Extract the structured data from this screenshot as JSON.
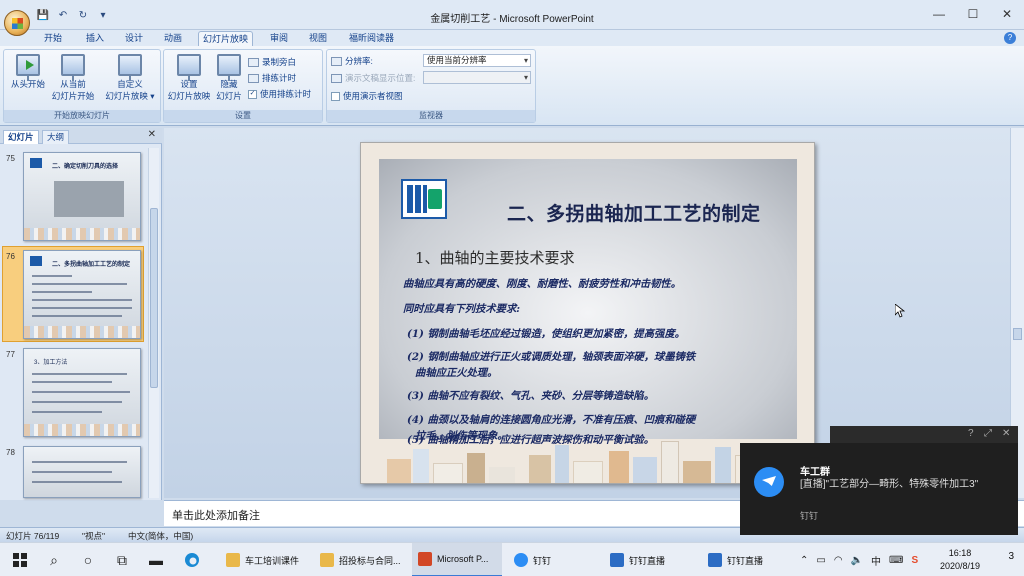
{
  "window": {
    "title": "金属切削工艺 - Microsoft PowerPoint"
  },
  "tabs": [
    "开始",
    "插入",
    "设计",
    "动画",
    "幻灯片放映",
    "审阅",
    "视图",
    "福昕阅读器"
  ],
  "ribbon": {
    "group_start": {
      "label": "开始放映幻灯片",
      "from_beginning": "从头开始",
      "from_current_1": "从当前",
      "from_current_2": "幻灯片开始",
      "custom_1": "自定义",
      "custom_2": "幻灯片放映 ▾"
    },
    "group_setup": {
      "label": "设置",
      "setup_1": "设置",
      "setup_2": "幻灯片放映",
      "hide_1": "隐藏",
      "hide_2": "幻灯片",
      "record": "录制旁白",
      "rehearse": "排练计时",
      "use_timings": "使用排练计时"
    },
    "group_monitors": {
      "label": "监视器",
      "resolution_label": "分辨率:",
      "resolution_value": "使用当前分辨率",
      "show_on_label": "演示文稿显示位置:",
      "presenter_view": "使用演示者视图"
    }
  },
  "left_pane": {
    "tab_slides": "幻灯片",
    "tab_outline": "大纲",
    "thumbnails": [
      {
        "num": "75",
        "title": "二、确定切削刀具的选择"
      },
      {
        "num": "76",
        "title": "二、多拐曲轴加工工艺的制定",
        "selected": true
      },
      {
        "num": "77",
        "title": "3、加工方法"
      },
      {
        "num": "78",
        "title": ""
      }
    ]
  },
  "slide": {
    "title": "二、多拐曲轴加工工艺的制定",
    "subtitle": "1、曲轴的主要技术要求",
    "lines": [
      "曲轴应具有高的硬度、刚度、耐磨性、耐疲劳性和冲击韧性。",
      "同时应具有下列技术要求:",
      "(1) 钢制曲轴毛坯应经过锻造，使组织更加紧密，提高强度。",
      "(2) 钢制曲轴应进行正火或调质处理，轴颈表面淬硬，球墨铸铁",
      "曲轴应正火处理。",
      "(3) 曲轴不应有裂纹、气孔、夹砂、分层等铸造缺陷。",
      "(4) 曲颈以及轴肩的连接圆角应光滑，不准有压痕、凹痕和碰硬",
      "拉毛、划伤等现象。",
      "(5) 曲轴精加工后，应进行超声波探伤和动平衡试验。"
    ]
  },
  "notes": {
    "placeholder": "单击此处添加备注"
  },
  "statusbar": {
    "slide_pos": "幻灯片 76/119",
    "theme": "\"视点\"",
    "language": "中文(简体，中国)"
  },
  "toast": {
    "title": "车工群",
    "body": "[直播]\"工艺部分—畸形、特殊零件加工3\"",
    "app": "钉钉"
  },
  "taskbar": {
    "apps": [
      "车工培训课件",
      "招投标与合同...",
      "Microsoft P...",
      "钉钉",
      "钉钉直播",
      "钉钉直播"
    ],
    "tray_lang": "中",
    "time": "16:18",
    "date": "2020/8/19",
    "notif_count": "3"
  }
}
